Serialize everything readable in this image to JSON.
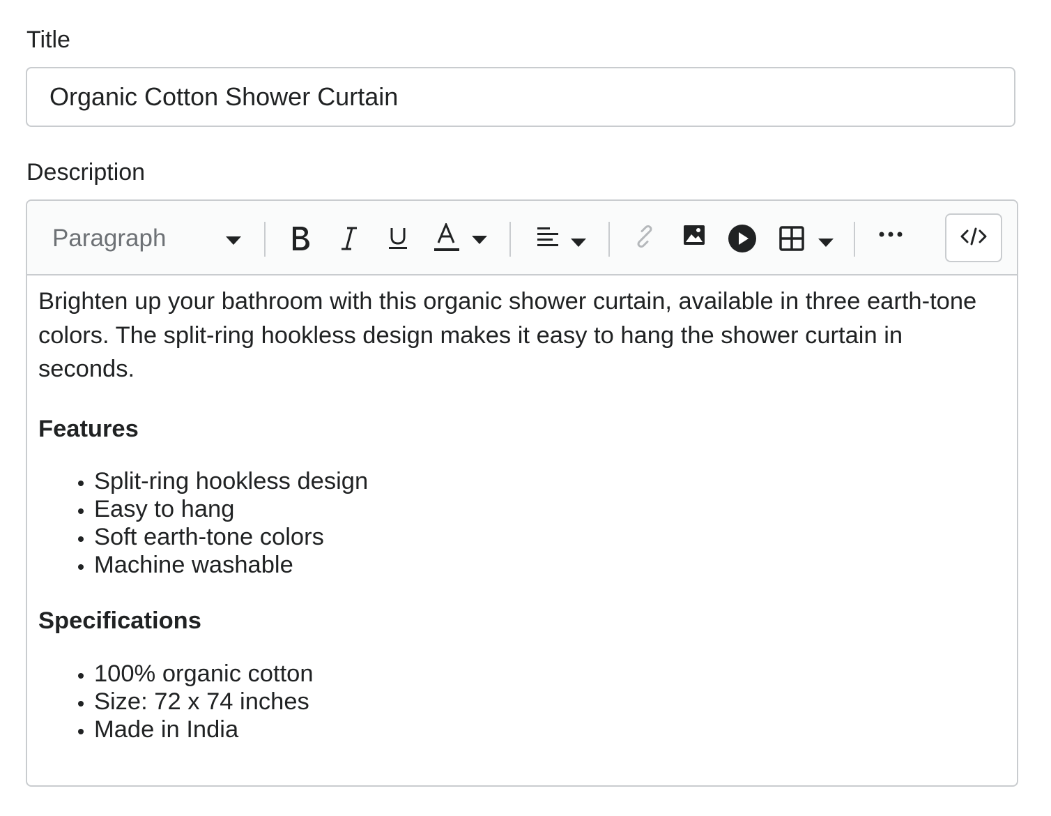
{
  "title_field": {
    "label": "Title",
    "value": "Organic Cotton Shower Curtain"
  },
  "description_field": {
    "label": "Description"
  },
  "toolbar": {
    "format_select": "Paragraph",
    "buttons": [
      {
        "name": "bold",
        "icon": "bold-icon"
      },
      {
        "name": "italic",
        "icon": "italic-icon"
      },
      {
        "name": "underline",
        "icon": "underline-icon"
      },
      {
        "name": "text-color",
        "icon": "text-color-icon"
      },
      {
        "name": "align",
        "icon": "align-left-icon"
      },
      {
        "name": "link",
        "icon": "link-icon",
        "disabled": true
      },
      {
        "name": "image",
        "icon": "image-icon"
      },
      {
        "name": "video",
        "icon": "play-circle-icon"
      },
      {
        "name": "table",
        "icon": "table-icon"
      },
      {
        "name": "more",
        "icon": "more-horizontal-icon"
      },
      {
        "name": "source-code",
        "icon": "code-icon"
      }
    ],
    "colors": {
      "icon": "#202223",
      "disabled": "#b5b8bb",
      "border": "#c9cccf",
      "toolbar_bg": "#fafbfb"
    }
  },
  "editor_content": {
    "intro": "Brighten up your bathroom with this organic shower curtain, available in three earth-tone colors. The split-ring hookless design makes it easy to hang the shower curtain in seconds.",
    "features_heading": "Features",
    "features": [
      "Split-ring hookless design",
      "Easy to hang",
      "Soft earth-tone colors",
      "Machine washable"
    ],
    "specs_heading": "Specifications",
    "specs": [
      "100% organic cotton",
      "Size: 72 x 74 inches",
      "Made in India"
    ]
  }
}
